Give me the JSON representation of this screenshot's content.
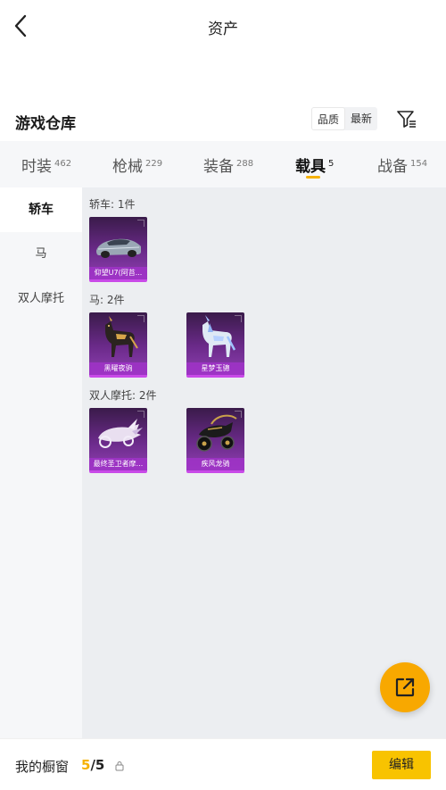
{
  "header": {
    "title": "资产"
  },
  "section": {
    "title": "游戏仓库",
    "sort_options": [
      "品质",
      "最新"
    ],
    "active_sort": "品质"
  },
  "tabs": [
    {
      "label": "时装",
      "count": "462"
    },
    {
      "label": "枪械",
      "count": "229"
    },
    {
      "label": "装备",
      "count": "288"
    },
    {
      "label": "载具",
      "count": "5"
    },
    {
      "label": "战备",
      "count": "154"
    }
  ],
  "active_tab": "载具",
  "subnav": [
    {
      "label": "轿车"
    },
    {
      "label": "马"
    },
    {
      "label": "双人摩托"
    }
  ],
  "active_subnav": "轿车",
  "groups": [
    {
      "label": "轿车: 1件",
      "items": [
        {
          "name": "仰望U7(阿苔..."
        }
      ]
    },
    {
      "label": "马: 2件",
      "items": [
        {
          "name": "黑曜夜驹"
        },
        {
          "name": "星梦玉骢"
        }
      ]
    },
    {
      "label": "双人摩托: 2件",
      "items": [
        {
          "name": "最终圣卫者摩..."
        },
        {
          "name": "疾风龙骑"
        }
      ]
    }
  ],
  "bottom": {
    "showcase_label": "我的橱窗",
    "showcase_used": "5",
    "showcase_sep": "/",
    "showcase_total": "5",
    "edit_label": "编辑"
  },
  "colors": {
    "accent": "#f6b100",
    "edit_button": "#f8c300",
    "fab": "#f8a800",
    "card_purple": "#8e3fb0"
  },
  "icons": {
    "back": "chevron-left-icon",
    "filter": "filter-icon",
    "share": "share-external-icon",
    "lock": "lock-icon"
  }
}
